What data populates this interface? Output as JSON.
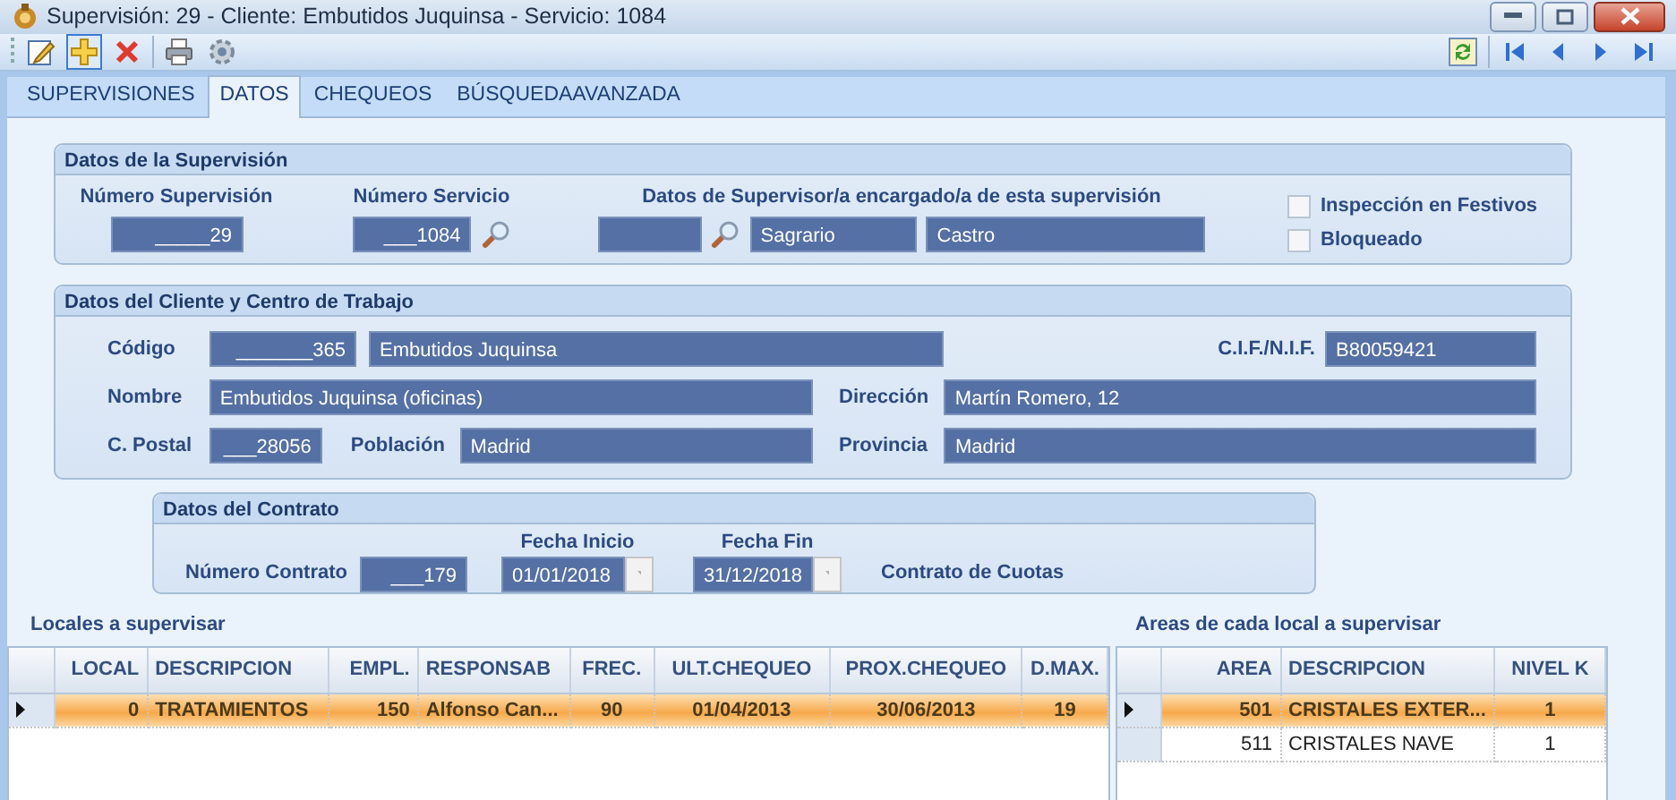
{
  "window": {
    "title": "Supervisión: 29 - Cliente: Embutidos Juquinsa - Servicio: 1084"
  },
  "tabs": [
    {
      "label": "SUPERVISIONES",
      "selected": false
    },
    {
      "label": "DATOS",
      "selected": true
    },
    {
      "label": "CHEQUEOS",
      "selected": false
    },
    {
      "label": "BÚSQUEDAAVANZADA",
      "selected": false
    }
  ],
  "supervision": {
    "title": "Datos de la Supervisión",
    "numero_supervision": {
      "label": "Número Supervisión",
      "value": "_____29"
    },
    "numero_servicio": {
      "label": "Número Servicio",
      "value": "___1084"
    },
    "supervisor": {
      "label": "Datos de Supervisor/a encargado/a de esta supervisión",
      "first_name": "Sagrario",
      "last_name": "Castro"
    },
    "checkboxes": [
      {
        "label": "Inspección en Festivos",
        "checked": false
      },
      {
        "label": "Bloqueado",
        "checked": false
      }
    ]
  },
  "client": {
    "title": "Datos del Cliente y Centro de Trabajo",
    "codigo": {
      "label": "Código",
      "value": "_______365",
      "name": "Embutidos Juquinsa"
    },
    "cif": {
      "label": "C.I.F./N.I.F.",
      "value": "B80059421"
    },
    "nombre": {
      "label": "Nombre",
      "value": "Embutidos Juquinsa (oficinas)"
    },
    "direccion": {
      "label": "Dirección",
      "value": "Martín Romero, 12"
    },
    "postal": {
      "label": "C. Postal",
      "value": "___28056"
    },
    "poblacion": {
      "label": "Población",
      "value": "Madrid"
    },
    "provincia": {
      "label": "Provincia",
      "value": "Madrid"
    }
  },
  "contract": {
    "title": "Datos del Contrato",
    "numero": {
      "label": "Número Contrato",
      "value": "___179"
    },
    "fecha_inicio": {
      "label": "Fecha Inicio",
      "value": "01/01/2018"
    },
    "fecha_fin": {
      "label": "Fecha Fin",
      "value": "31/12/2018"
    },
    "cuotas": {
      "label": "Contrato de Cuotas"
    }
  },
  "locales": {
    "title": "Locales a supervisar",
    "columns": [
      "LOCAL",
      "DESCRIPCION",
      "EMPL.",
      "RESPONSAB",
      "FREC.",
      "ULT.CHEQUEO",
      "PROX.CHEQUEO",
      "D.MAX."
    ],
    "rows": [
      {
        "selected": true,
        "cells": [
          "0",
          "TRATAMIENTOS",
          "150",
          "Alfonso Can...",
          "90",
          "01/04/2013",
          "30/06/2013",
          "19"
        ]
      }
    ]
  },
  "areas": {
    "title": "Areas de cada local a supervisar",
    "columns": [
      "AREA",
      "DESCRIPCION",
      "NIVEL K"
    ],
    "rows": [
      {
        "selected": true,
        "cells": [
          "501",
          "CRISTALES EXTER...",
          "1"
        ]
      },
      {
        "selected": false,
        "cells": [
          "511",
          "CRISTALES NAVE",
          "1"
        ]
      }
    ]
  }
}
